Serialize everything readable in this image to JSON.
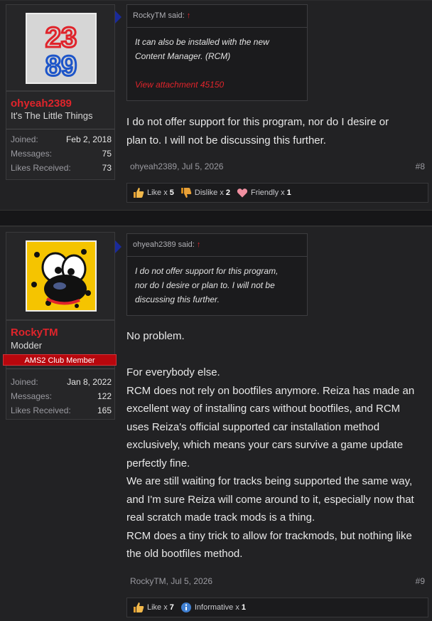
{
  "posts": [
    {
      "user": {
        "name": "ohyeah2389",
        "title": "It's The Little Things",
        "avatar_text": [
          "23",
          "89"
        ],
        "stats": [
          {
            "label": "Joined:",
            "value": "Feb 2, 2018"
          },
          {
            "label": "Messages:",
            "value": "75"
          },
          {
            "label": "Likes Received:",
            "value": "73"
          }
        ]
      },
      "quote": {
        "author": "RockyTM said:",
        "arrow": "↑",
        "lines": [
          "It can also be installed with the new",
          "Content Manager. (RCM)"
        ],
        "link": "View attachment 45150"
      },
      "message": [
        "I do not offer support for this program, nor do I desire or",
        "plan to. I will not be discussing this further."
      ],
      "meta": "ohyeah2389, Jul 5, 2026",
      "permalink": "#8",
      "reactions": [
        {
          "icon": "like-icon",
          "label": "Like",
          "x": "x",
          "count": "5"
        },
        {
          "icon": "dislike-icon",
          "label": "Dislike",
          "x": "x",
          "count": "2"
        },
        {
          "icon": "friendly-icon",
          "label": "Friendly",
          "x": "x",
          "count": "1"
        }
      ]
    },
    {
      "user": {
        "name": "RockyTM",
        "title": "Modder",
        "banner": "AMS2 Club Member",
        "stats": [
          {
            "label": "Joined:",
            "value": "Jan 8, 2022"
          },
          {
            "label": "Messages:",
            "value": "122"
          },
          {
            "label": "Likes Received:",
            "value": "165"
          }
        ]
      },
      "quote": {
        "author": "ohyeah2389 said:",
        "arrow": "↑",
        "lines": [
          "I do not offer support for this program,",
          "nor do I desire or plan to. I will not be",
          "discussing this further."
        ]
      },
      "message": [
        "No problem.",
        "",
        "For everybody else.",
        "RCM does not rely on bootfiles anymore. Reiza has made an",
        "excellent way of installing cars without bootfiles, and RCM",
        "uses Reiza's official supported car installation method",
        "exclusively, which means your cars survive a game update",
        "perfectly fine.",
        "We are still waiting for tracks being supported the same way,",
        "and I'm sure Reiza will come around to it, especially now that",
        "real scratch made track mods is a thing.",
        "RCM does a tiny trick to allow for trackmods, but nothing like",
        "the old bootfiles method."
      ],
      "meta": "RockyTM, Jul 5, 2026",
      "permalink": "#9",
      "reactions": [
        {
          "icon": "like-icon",
          "label": "Like",
          "x": "x",
          "count": "7"
        },
        {
          "icon": "informative-icon",
          "label": "Informative",
          "x": "x",
          "count": "1"
        }
      ]
    }
  ],
  "colors": {
    "username": "#e0242b",
    "banner": "#b8070d",
    "pointer": "#1a2a9a"
  }
}
